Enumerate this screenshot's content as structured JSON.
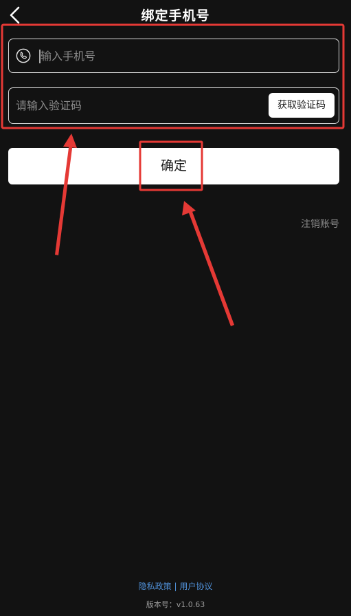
{
  "header": {
    "title": "绑定手机号",
    "back_icon": "chevron-left-icon"
  },
  "form": {
    "phone_placeholder": "输入手机号",
    "phone_icon": "phone-icon",
    "code_placeholder": "请输入验证码",
    "get_code_label": "获取验证码"
  },
  "confirm_label": "确定",
  "cancel_account_label": "注销账号",
  "footer": {
    "privacy_label": "隐私政策",
    "separator": "|",
    "agreement_label": "用户协议",
    "version_text": "版本号：v1.0.63"
  },
  "colors": {
    "background": "#121212",
    "annotation_red": "#e53935",
    "link_blue": "#4f8fd6"
  }
}
